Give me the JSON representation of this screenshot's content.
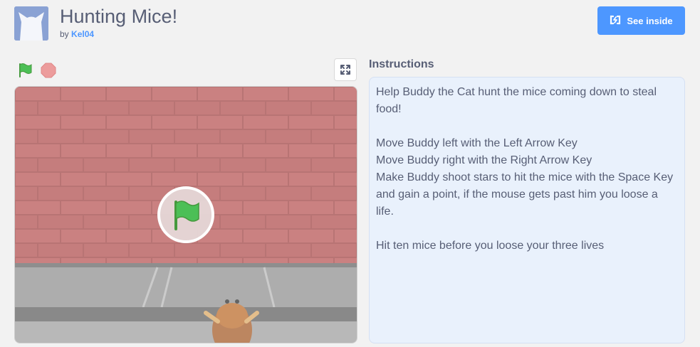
{
  "project": {
    "title": "Hunting Mice!",
    "by_label": "by",
    "author": "Kel04"
  },
  "header": {
    "see_inside_label": "See inside"
  },
  "player": {
    "controls": {
      "green_flag_icon": "green-flag-icon",
      "stop_icon": "stop-icon",
      "fullscreen_icon": "fullscreen-icon"
    }
  },
  "instructions": {
    "heading": "Instructions",
    "lines": [
      "Help Buddy the Cat hunt the mice coming down to steal food!",
      "",
      "Move Buddy left with the Left Arrow Key",
      "Move Buddy right with the Right Arrow Key",
      "Make Buddy shoot stars to hit the mice with the Space Key and gain a point, if the mouse gets past him you loose a life.",
      "",
      "Hit ten mice before you loose your three lives"
    ]
  },
  "colors": {
    "accent": "#4d97ff",
    "text": "#575e75",
    "instructions_bg": "#e9f1fc",
    "green_flag": "#4cbf56",
    "stop": "#ec5959"
  }
}
